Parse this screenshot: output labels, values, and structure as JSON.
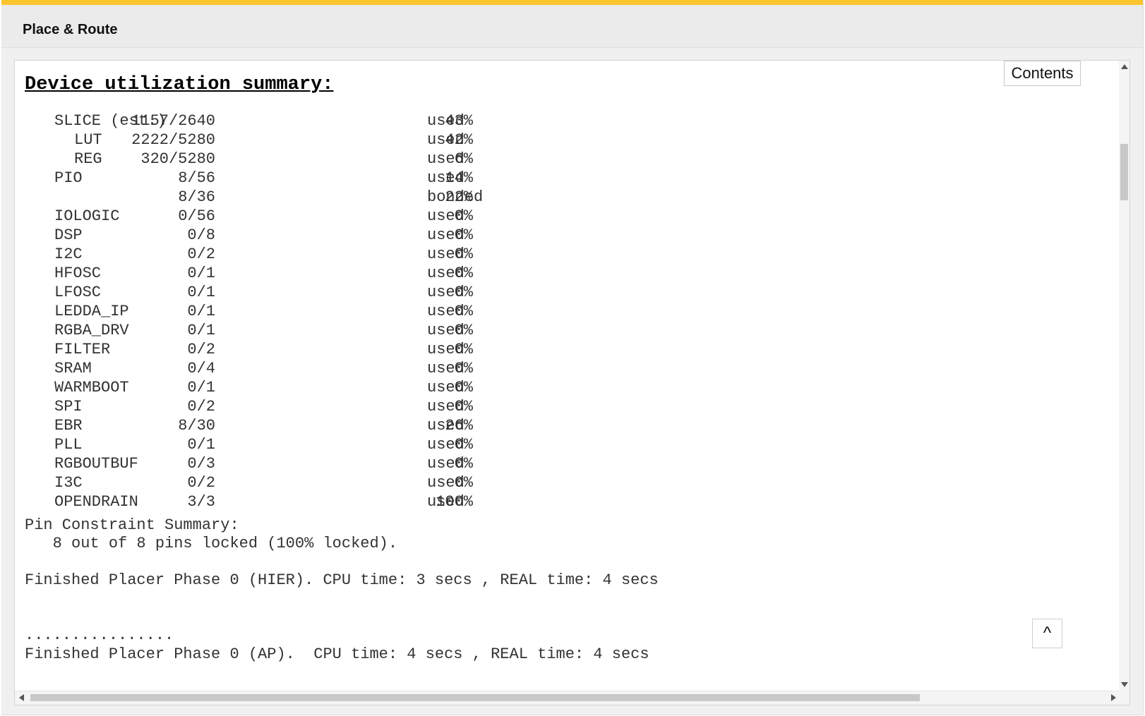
{
  "header": {
    "title": "Place & Route"
  },
  "toolbar": {
    "contents_label": "Contents",
    "back_to_top_label": "^"
  },
  "colors": {
    "accent": "#fcc52f"
  },
  "report": {
    "title": "Device utilization summary:",
    "rows": [
      {
        "name": "SLICE (est.)",
        "count": "1157/2640",
        "percent": "43%",
        "status": "used",
        "indent": false
      },
      {
        "name": "LUT",
        "count": "2222/5280",
        "percent": "42%",
        "status": "used",
        "indent": true
      },
      {
        "name": "REG",
        "count": "320/5280",
        "percent": "6%",
        "status": "used",
        "indent": true
      },
      {
        "name": "PIO",
        "count": "8/56",
        "percent": "14%",
        "status": "used",
        "indent": false
      },
      {
        "name": "",
        "count": "8/36",
        "percent": "22%",
        "status": "bonded",
        "indent": false
      },
      {
        "name": "IOLOGIC",
        "count": "0/56",
        "percent": "0%",
        "status": "used",
        "indent": false
      },
      {
        "name": "DSP",
        "count": "0/8",
        "percent": "0%",
        "status": "used",
        "indent": false
      },
      {
        "name": "I2C",
        "count": "0/2",
        "percent": "0%",
        "status": "used",
        "indent": false
      },
      {
        "name": "HFOSC",
        "count": "0/1",
        "percent": "0%",
        "status": "used",
        "indent": false
      },
      {
        "name": "LFOSC",
        "count": "0/1",
        "percent": "0%",
        "status": "used",
        "indent": false
      },
      {
        "name": "LEDDA_IP",
        "count": "0/1",
        "percent": "0%",
        "status": "used",
        "indent": false
      },
      {
        "name": "RGBA_DRV",
        "count": "0/1",
        "percent": "0%",
        "status": "used",
        "indent": false
      },
      {
        "name": "FILTER",
        "count": "0/2",
        "percent": "0%",
        "status": "used",
        "indent": false
      },
      {
        "name": "SRAM",
        "count": "0/4",
        "percent": "0%",
        "status": "used",
        "indent": false
      },
      {
        "name": "WARMBOOT",
        "count": "0/1",
        "percent": "0%",
        "status": "used",
        "indent": false
      },
      {
        "name": "SPI",
        "count": "0/2",
        "percent": "0%",
        "status": "used",
        "indent": false
      },
      {
        "name": "EBR",
        "count": "8/30",
        "percent": "26%",
        "status": "used",
        "indent": false
      },
      {
        "name": "PLL",
        "count": "0/1",
        "percent": "0%",
        "status": "used",
        "indent": false
      },
      {
        "name": "RGBOUTBUF",
        "count": "0/3",
        "percent": "0%",
        "status": "used",
        "indent": false
      },
      {
        "name": "I3C",
        "count": "0/2",
        "percent": "0%",
        "status": "used",
        "indent": false
      },
      {
        "name": "OPENDRAIN",
        "count": "3/3",
        "percent": "100%",
        "status": "used",
        "indent": false
      }
    ],
    "pin_summary_heading": "Pin Constraint Summary:",
    "pin_summary_detail": "   8 out of 8 pins locked (100% locked).",
    "placer_hier_line": "Finished Placer Phase 0 (HIER). CPU time: 3 secs , REAL time: 4 secs",
    "progress_dots": "................",
    "placer_ap_line": "Finished Placer Phase 0 (AP).  CPU time: 4 secs , REAL time: 4 secs"
  }
}
